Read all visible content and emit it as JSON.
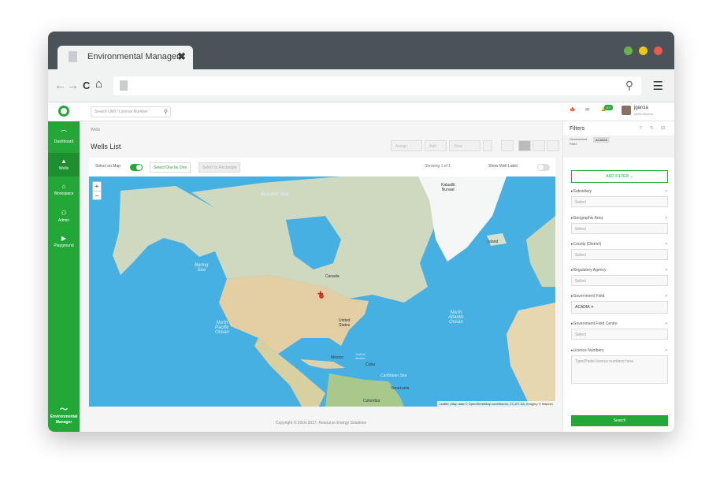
{
  "browser": {
    "tab_title": "Environmental Manager",
    "tab_close": "✖",
    "back": "←",
    "forward": "→",
    "reload": "C",
    "home": "⌂",
    "menu": "☰",
    "search_glyph": "⚲",
    "controls": {
      "green": "#6ab04c",
      "yellow": "#f0c419",
      "red": "#e55b4d"
    }
  },
  "sidebar": {
    "items": [
      {
        "label": "Dashboard",
        "icon": "⌒"
      },
      {
        "label": "Wells",
        "icon": "▲"
      },
      {
        "label": "Workspace",
        "icon": "⌂"
      },
      {
        "label": "Admin",
        "icon": "⚇"
      },
      {
        "label": "Playground",
        "icon": "▶"
      }
    ],
    "brand_line1": "Environmental",
    "brand_line2": "Manager",
    "color": "#23a838"
  },
  "header": {
    "search_placeholder": "Search UWI / License Number",
    "search_glyph": "⚲",
    "flag": "🍁",
    "mail": "✉",
    "bell": "🔔",
    "notification_count": "107",
    "user_name": "jgarcia",
    "user_role": "systemAdmin"
  },
  "main": {
    "breadcrumb": "Wells",
    "title": "Wells List",
    "actions": {
      "assign": "Assign",
      "add": "Add",
      "view": "View"
    },
    "select_on_map": "Select on Map",
    "select_one_by_one": "Select One by One",
    "select_rectangle": "Select In Rectangle",
    "showing": "Showing 1 of 1",
    "show_well_label": "Show Well Label"
  },
  "map": {
    "zoom_in": "+",
    "zoom_out": "−",
    "labels": {
      "kalaallit": "Kalaallit\nNunaat",
      "canada": "Canada",
      "us": "United\nStates",
      "mexico": "México",
      "cuba": "Cuba",
      "venezuela": "Venezuela",
      "colombia": "Colombia",
      "iceland": "Ísland",
      "north_pacific": "North\nPacific\nOcean",
      "north_atlantic": "North\nAtlantic\nOcean",
      "bering": "Bering\nSea",
      "beaufort": "Beaufort Sea",
      "gulf": "Gulf of\nMexico",
      "caribbean": "Caribbean Sea"
    },
    "attribution": "Leaflet | Map data © OpenStreetMap contributors, CC-BY-SA, Imagery © Mapbox",
    "marker": "✚"
  },
  "footer": {
    "copyright": "Copyright © 2016-2017, Resource Energy Solutions"
  },
  "filters": {
    "title": "Filters",
    "chip_label": "Government Field",
    "chip_value": "ACADIA",
    "add_filter": "ADD FILTER ⌄",
    "rows": [
      {
        "label": "Subsidiary",
        "value": "Select"
      },
      {
        "label": "Geographic Area",
        "value": "Select"
      },
      {
        "label": "County (District)",
        "value": "Select"
      },
      {
        "label": "Regulatory Agency",
        "value": "Select"
      },
      {
        "label": "Government Field",
        "value": "ACADIA ✕"
      },
      {
        "label": "Government Field Centre",
        "value": "Select"
      },
      {
        "label": "Licence Numbers",
        "value": "Type/Paste licence numbers here"
      }
    ],
    "search_button": "Search"
  }
}
